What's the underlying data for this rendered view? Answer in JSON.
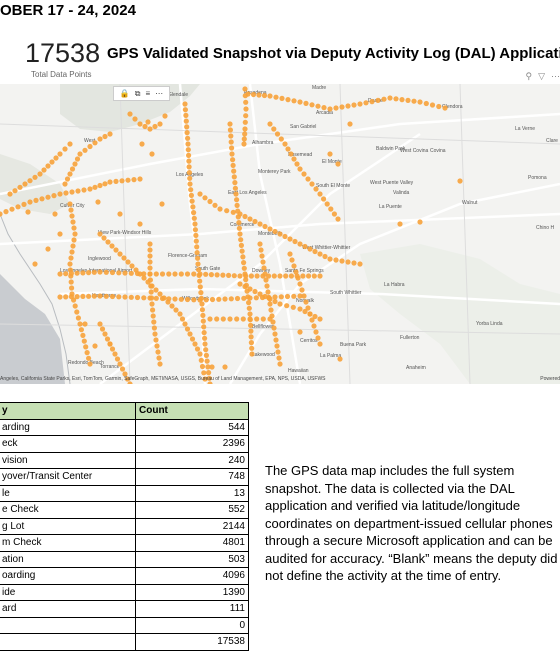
{
  "header": {
    "date_range": "OBER 17 - 24, 2024"
  },
  "kpi": {
    "value": "17538",
    "label": "Total Data Points"
  },
  "map": {
    "title": "GPS Validated Snapshot via Deputy Activity Log (DAL) Application",
    "toolbar_icons": [
      "pin-icon",
      "filter-icon",
      "more-icon"
    ],
    "control_icons": [
      "lock-icon",
      "copy-icon",
      "filter-icon",
      "more-icon"
    ],
    "marker_color": "#f7a23a",
    "attribution": "Angeles, California State Parks, Esri, TomTom, Garmin, SafeGraph, METI/NASA, USGS, Bureau of Land Management, EPA, NPS, USDA, USFWS",
    "attribution_right": "Powered",
    "places": [
      "Glendale",
      "Madre",
      "Duarte",
      "Glendora",
      "Pasadena",
      "Arcadia",
      "La Verne",
      "Clare",
      "West",
      "Alhambra",
      "San Gabriel",
      "Baldwin Park",
      "West Covina",
      "Covina",
      "Rosemead",
      "El Monte",
      "Los Angeles",
      "Monterey Park",
      "South El Monte",
      "West Puente Valley",
      "Valinda",
      "Pomona",
      "Culver City",
      "East Los Angeles",
      "La Puente",
      "Walnut",
      "Montebello",
      "Chino H",
      "View Park-Windsor Hills",
      "Commerce",
      "Florence-Graham",
      "West Whittier-Whittier",
      "Inglewood",
      "Los Angeles International Airport",
      "South Gate",
      "Santa Fe Springs",
      "Downey",
      "La Habra",
      "Hawthorne",
      "Willowbrook",
      "Norwalk",
      "South Whittier",
      "Yorba Linda",
      "Cerritos",
      "Buena Park",
      "Fullerton",
      "Bellflower",
      "La Palma",
      "Redondo Beach",
      "Torrance",
      "Lakewood",
      "Hawaiian",
      "Anaheim"
    ]
  },
  "table": {
    "headers": [
      "y",
      "Count"
    ],
    "rows": [
      [
        "arding",
        "544"
      ],
      [
        "eck",
        "2396"
      ],
      [
        "vision",
        "240"
      ],
      [
        "yover/Transit Center",
        "748"
      ],
      [
        "le",
        "13"
      ],
      [
        "e Check",
        "552"
      ],
      [
        "g Lot",
        "2144"
      ],
      [
        "m Check",
        "4801"
      ],
      [
        "ation",
        "503"
      ],
      [
        "oarding",
        "4096"
      ],
      [
        "ide",
        "1390"
      ],
      [
        "ard",
        "111"
      ],
      [
        "",
        "0"
      ],
      [
        "",
        "17538"
      ]
    ]
  },
  "note": "The GPS data map includes the full system snapshot. The data is collected via the DAL application and verified via latitude/longitude coordinates on department-issued cellular phones through a secure Microsoft application and can be audited for accuracy. “Blank” means the deputy did not define the activity at the time of entry."
}
